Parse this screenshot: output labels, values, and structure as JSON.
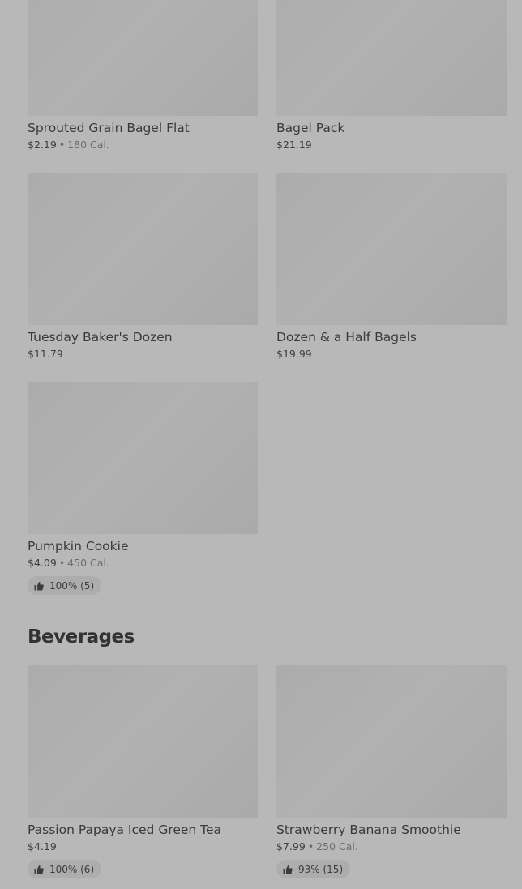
{
  "items": [
    {
      "name": "Sprouted Grain Bagel Flat",
      "price": "$2.19",
      "calories": "180 Cal."
    },
    {
      "name": "Bagel Pack",
      "price": "$21.19"
    },
    {
      "name": "Tuesday Baker's Dozen",
      "price": "$11.79"
    },
    {
      "name": "Dozen & a Half Bagels",
      "price": "$19.99"
    },
    {
      "name": "Pumpkin Cookie",
      "price": "$4.09",
      "calories": "450 Cal.",
      "rating": "100% (5)"
    }
  ],
  "beverages": {
    "title": "Beverages",
    "items": [
      {
        "name": "Passion Papaya Iced Green Tea",
        "price": "$4.19",
        "rating": "100% (6)"
      },
      {
        "name": "Strawberry Banana Smoothie",
        "price": "$7.99",
        "calories": "250 Cal.",
        "rating": "93% (15)"
      }
    ]
  },
  "separator": "•",
  "icons": {
    "rating": "thumbs-up-icon"
  },
  "colors": {
    "background": "#b8b8b8",
    "thumbnail": "#afafaf"
  }
}
